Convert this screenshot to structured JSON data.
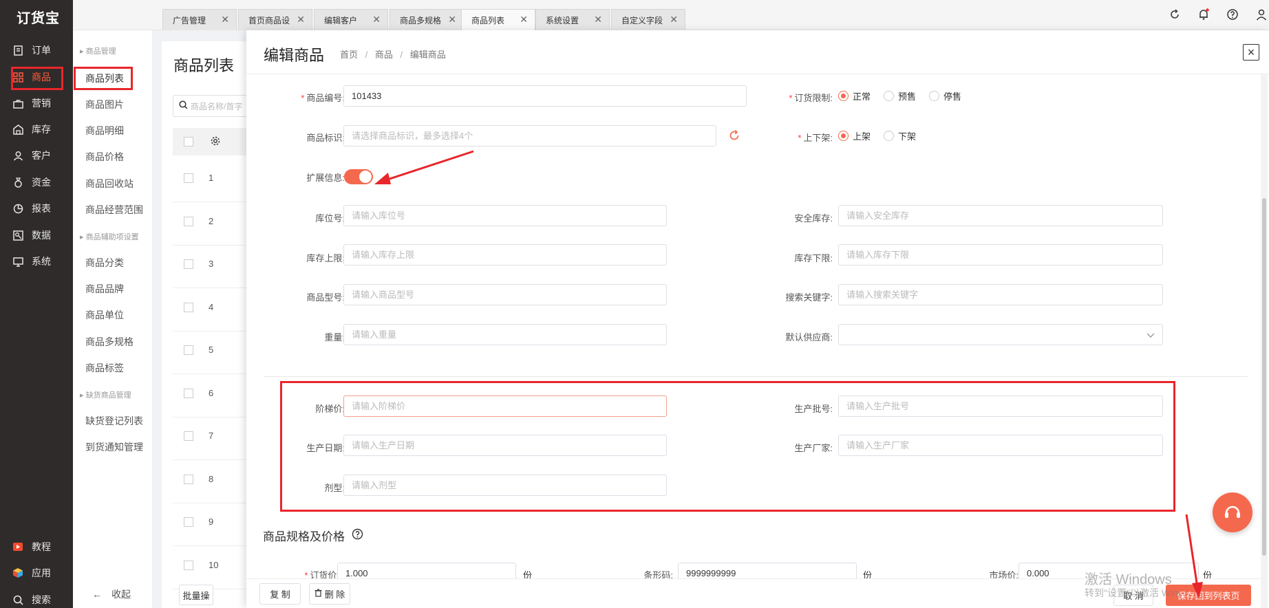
{
  "app": {
    "logo": "订货宝"
  },
  "nav": {
    "items": [
      {
        "label": "订单",
        "icon": "order-icon"
      },
      {
        "label": "商品",
        "icon": "grid-icon"
      },
      {
        "label": "营销",
        "icon": "marketing-icon"
      },
      {
        "label": "库存",
        "icon": "warehouse-icon"
      },
      {
        "label": "客户",
        "icon": "user-icon"
      },
      {
        "label": "资金",
        "icon": "money-bag-icon"
      },
      {
        "label": "报表",
        "icon": "pie-chart-icon"
      },
      {
        "label": "数据",
        "icon": "data-icon"
      },
      {
        "label": "系统",
        "icon": "monitor-icon"
      }
    ],
    "bottom": [
      {
        "label": "教程",
        "icon": "play-icon"
      },
      {
        "label": "应用",
        "icon": "cube-icon"
      },
      {
        "label": "搜索",
        "icon": "search-icon"
      }
    ]
  },
  "submenu": {
    "group1": "商品管理",
    "items1": [
      "商品列表",
      "商品图片",
      "商品明细",
      "商品价格",
      "商品回收站",
      "商品经营范围"
    ],
    "group2": "商品辅助项设置",
    "items2": [
      "商品分类",
      "商品品牌",
      "商品单位",
      "商品多规格",
      "商品标签"
    ],
    "group3": "缺货商品管理",
    "items3": [
      "缺货登记列表",
      "到货通知管理"
    ],
    "collapse": "收起"
  },
  "tabs": [
    "广告管理",
    "首页商品设",
    "编辑客户",
    "商品多规格",
    "商品列表",
    "系统设置",
    "自定义字段"
  ],
  "list": {
    "title": "商品列表",
    "search_placeholder": "商品名称/首字",
    "rows": [
      "1",
      "2",
      "3",
      "4",
      "5",
      "6",
      "7",
      "8",
      "9",
      "10"
    ],
    "batch": "批量操"
  },
  "drawer": {
    "title": "编辑商品",
    "breadcrumb": [
      "首页",
      "商品",
      "编辑商品"
    ],
    "close": "×",
    "form": {
      "code": {
        "label": "商品编号:",
        "value": "101433"
      },
      "order_limit": {
        "label": "订货限制:",
        "options": [
          "正常",
          "预售",
          "停售"
        ],
        "selected": 0
      },
      "tag": {
        "label": "商品标识:",
        "placeholder": "请选择商品标识，最多选择4个"
      },
      "shelf": {
        "label": "上下架:",
        "options": [
          "上架",
          "下架"
        ],
        "selected": 0
      },
      "ext": {
        "label": "扩展信息:",
        "on": true
      },
      "location": {
        "label": "库位号:",
        "placeholder": "请输入库位号"
      },
      "safety": {
        "label": "安全库存:",
        "placeholder": "请输入安全库存"
      },
      "stock_max": {
        "label": "库存上限:",
        "placeholder": "请输入库存上限"
      },
      "stock_min": {
        "label": "库存下限:",
        "placeholder": "请输入库存下限"
      },
      "model": {
        "label": "商品型号:",
        "placeholder": "请输入商品型号"
      },
      "keyword": {
        "label": "搜索关键字:",
        "placeholder": "请输入搜索关键字"
      },
      "weight": {
        "label": "重量:",
        "placeholder": "请输入重量"
      },
      "supplier": {
        "label": "默认供应商:",
        "value": ""
      },
      "tier": {
        "label": "阶梯价:",
        "placeholder": "请输入阶梯价"
      },
      "batch": {
        "label": "生产批号:",
        "placeholder": "请输入生产批号"
      },
      "date": {
        "label": "生产日期:",
        "placeholder": "请输入生产日期"
      },
      "maker": {
        "label": "生产厂家:",
        "placeholder": "请输入生产厂家"
      },
      "form_type": {
        "label": "剂型:",
        "placeholder": "请输入剂型"
      }
    },
    "spec_title": "商品规格及价格",
    "price": {
      "label": "订货价:",
      "value": "1.000",
      "unit": "份"
    },
    "barcode": {
      "label": "条形码:",
      "value": "9999999999",
      "unit": "份"
    },
    "market": {
      "label": "市场价:",
      "value": "0.000",
      "unit": "份"
    },
    "footer": {
      "copy": "复 制",
      "delete": "删 除",
      "cancel": "取 消",
      "save": "保存回到列表页"
    }
  },
  "watermark": {
    "line1": "激活 Windows",
    "line2": "转到\"设置\"以激活 Windows。"
  },
  "colors": {
    "accent": "#f4694e",
    "nav_bg": "#2f2b2a",
    "annotation_red": "#e8262b"
  }
}
